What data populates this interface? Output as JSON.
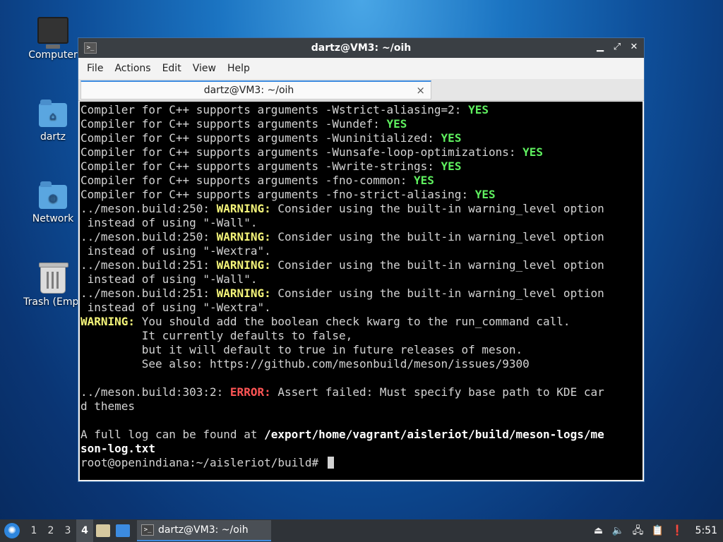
{
  "desktop": {
    "icons": [
      {
        "label": "Computer",
        "icon": "computer-icon"
      },
      {
        "label": "dartz",
        "icon": "home-folder-icon"
      },
      {
        "label": "Network",
        "icon": "network-folder-icon"
      },
      {
        "label": "Trash (Empt",
        "icon": "trash-icon"
      }
    ]
  },
  "window": {
    "title": "dartz@VM3: ~/oih",
    "menu": [
      "File",
      "Actions",
      "Edit",
      "View",
      "Help"
    ],
    "tab_label": "dartz@VM3: ~/oih",
    "tab_close": "×",
    "controls": {
      "minimize": "▁",
      "maximize": "⤢",
      "close": "✕"
    }
  },
  "terminal": {
    "lines": [
      [
        {
          "t": "Compiler for C++ supports arguments -Wstrict-aliasing=2: "
        },
        {
          "t": "YES",
          "c": "yes"
        }
      ],
      [
        {
          "t": "Compiler for C++ supports arguments -Wundef: "
        },
        {
          "t": "YES",
          "c": "yes"
        }
      ],
      [
        {
          "t": "Compiler for C++ supports arguments -Wuninitialized: "
        },
        {
          "t": "YES",
          "c": "yes"
        }
      ],
      [
        {
          "t": "Compiler for C++ supports arguments -Wunsafe-loop-optimizations: "
        },
        {
          "t": "YES",
          "c": "yes"
        }
      ],
      [
        {
          "t": "Compiler for C++ supports arguments -Wwrite-strings: "
        },
        {
          "t": "YES",
          "c": "yes"
        }
      ],
      [
        {
          "t": "Compiler for C++ supports arguments -fno-common: "
        },
        {
          "t": "YES",
          "c": "yes"
        }
      ],
      [
        {
          "t": "Compiler for C++ supports arguments -fno-strict-aliasing: "
        },
        {
          "t": "YES",
          "c": "yes"
        }
      ],
      [
        {
          "t": "../meson.build:250: "
        },
        {
          "t": "WARNING:",
          "c": "warn"
        },
        {
          "t": " Consider using the built-in warning_level option"
        }
      ],
      [
        {
          "t": " instead of using \"-Wall\"."
        }
      ],
      [
        {
          "t": "../meson.build:250: "
        },
        {
          "t": "WARNING:",
          "c": "warn"
        },
        {
          "t": " Consider using the built-in warning_level option"
        }
      ],
      [
        {
          "t": " instead of using \"-Wextra\"."
        }
      ],
      [
        {
          "t": "../meson.build:251: "
        },
        {
          "t": "WARNING:",
          "c": "warn"
        },
        {
          "t": " Consider using the built-in warning_level option"
        }
      ],
      [
        {
          "t": " instead of using \"-Wall\"."
        }
      ],
      [
        {
          "t": "../meson.build:251: "
        },
        {
          "t": "WARNING:",
          "c": "warn"
        },
        {
          "t": " Consider using the built-in warning_level option"
        }
      ],
      [
        {
          "t": " instead of using \"-Wextra\"."
        }
      ],
      [
        {
          "t": "WARNING:",
          "c": "warn"
        },
        {
          "t": " You should add the boolean check kwarg to the run_command call."
        }
      ],
      [
        {
          "t": "         It currently defaults to false,"
        }
      ],
      [
        {
          "t": "         but it will default to true in future releases of meson."
        }
      ],
      [
        {
          "t": "         See also: https://github.com/mesonbuild/meson/issues/9300"
        }
      ],
      [
        {
          "t": ""
        }
      ],
      [
        {
          "t": "../meson.build:303:2: "
        },
        {
          "t": "ERROR:",
          "c": "err"
        },
        {
          "t": " Assert failed: Must specify base path to KDE car"
        }
      ],
      [
        {
          "t": "d themes"
        }
      ],
      [
        {
          "t": ""
        }
      ],
      [
        {
          "t": "A full log can be found at "
        },
        {
          "t": "/export/home/vagrant/aisleriot/build/meson-logs/me",
          "c": "bold"
        }
      ],
      [
        {
          "t": "son-log.txt",
          "c": "bold"
        }
      ]
    ],
    "prompt": "root@openindiana:~/aisleriot/build# "
  },
  "taskbar": {
    "workspaces": [
      "1",
      "2",
      "3",
      "4"
    ],
    "active_workspace": "4",
    "task_label": "dartz@VM3: ~/oih",
    "clock": "5:51"
  }
}
